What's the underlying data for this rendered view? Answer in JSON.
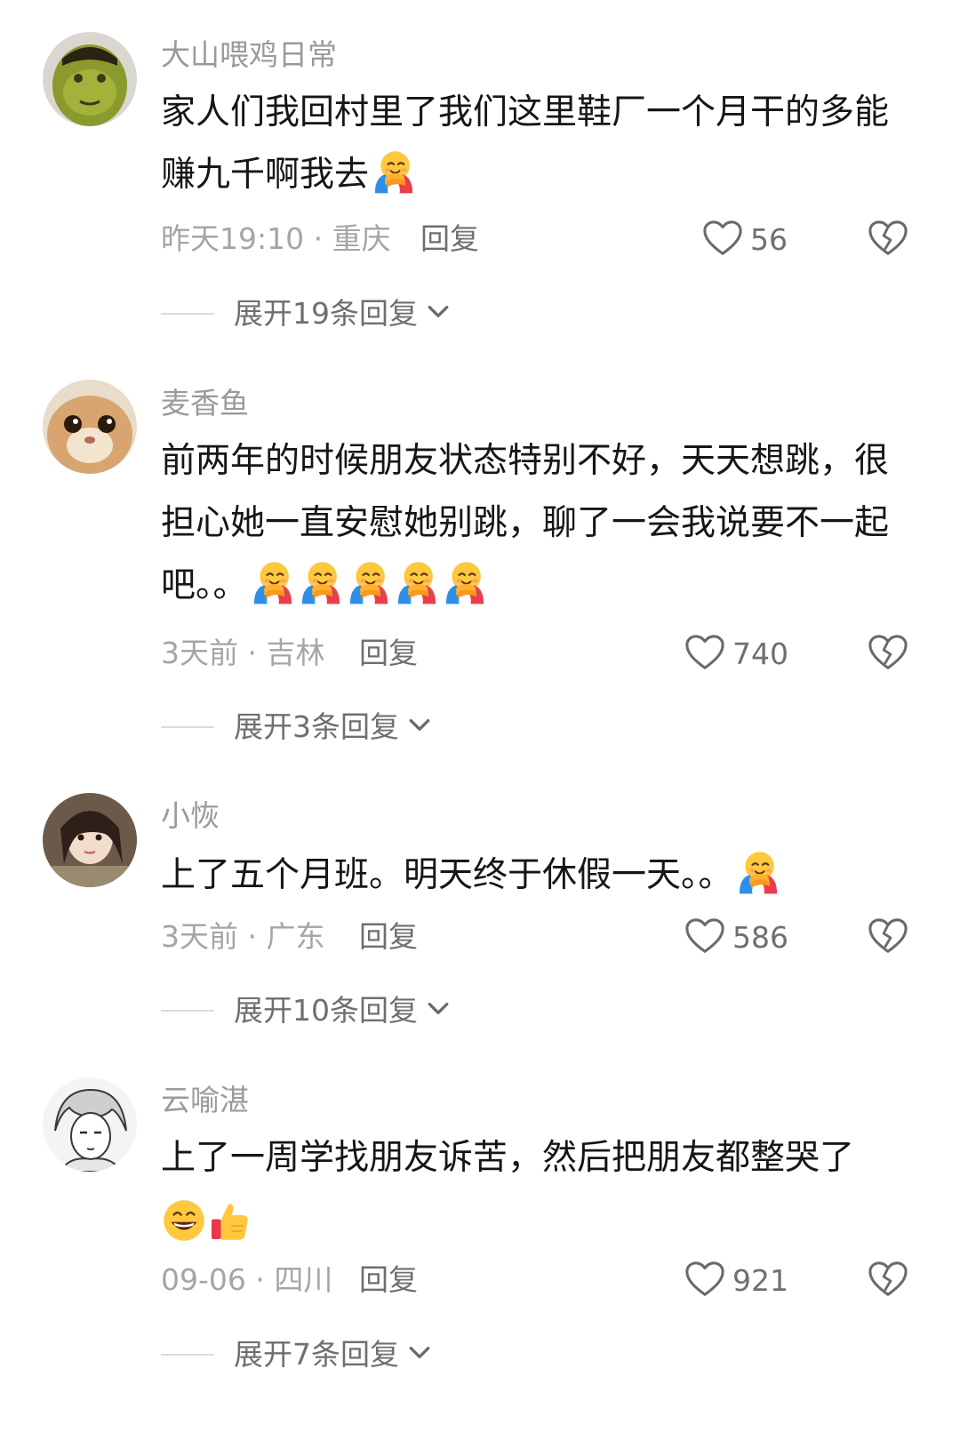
{
  "comments": [
    {
      "user": "大山喂鸡日常",
      "text": "家人们我回村里了我们这里鞋厂一个月干的多能赚九千啊我去",
      "emojis": [
        "hug-face-icon"
      ],
      "meta": "昨天19:10 · 重庆",
      "reply_label": "回复",
      "likes": "56",
      "expand_label": "展开19条回复"
    },
    {
      "user": "麦香鱼",
      "text": "前两年的时候朋友状态特别不好，天天想跳，很担心她一直安慰她别跳，聊了一会我说要不一起吧。。",
      "emojis": [
        "hug-face-icon",
        "hug-face-icon",
        "hug-face-icon",
        "hug-face-icon",
        "hug-face-icon"
      ],
      "meta": "3天前 · 吉林",
      "reply_label": "回复",
      "likes": "740",
      "expand_label": "展开3条回复"
    },
    {
      "user": "小恢",
      "text": "上了五个月班。明天终于休假一天。。",
      "emojis": [
        "hug-face-icon"
      ],
      "meta": "3天前 · 广东",
      "reply_label": "回复",
      "likes": "586",
      "expand_label": "展开10条回复"
    },
    {
      "user": "云喻湛",
      "text": "上了一周学找朋友诉苦，然后把朋友都整哭了",
      "emojis": [
        "grin-face-icon",
        "thumbs-up-icon"
      ],
      "meta": "09-06 · 四川",
      "reply_label": "回复",
      "likes": "921",
      "expand_label": "展开7条回复"
    }
  ],
  "colors": {
    "username": "#9a9a9a",
    "text": "#161616",
    "meta": "#a5a5a5",
    "action": "#6f6f6f"
  }
}
